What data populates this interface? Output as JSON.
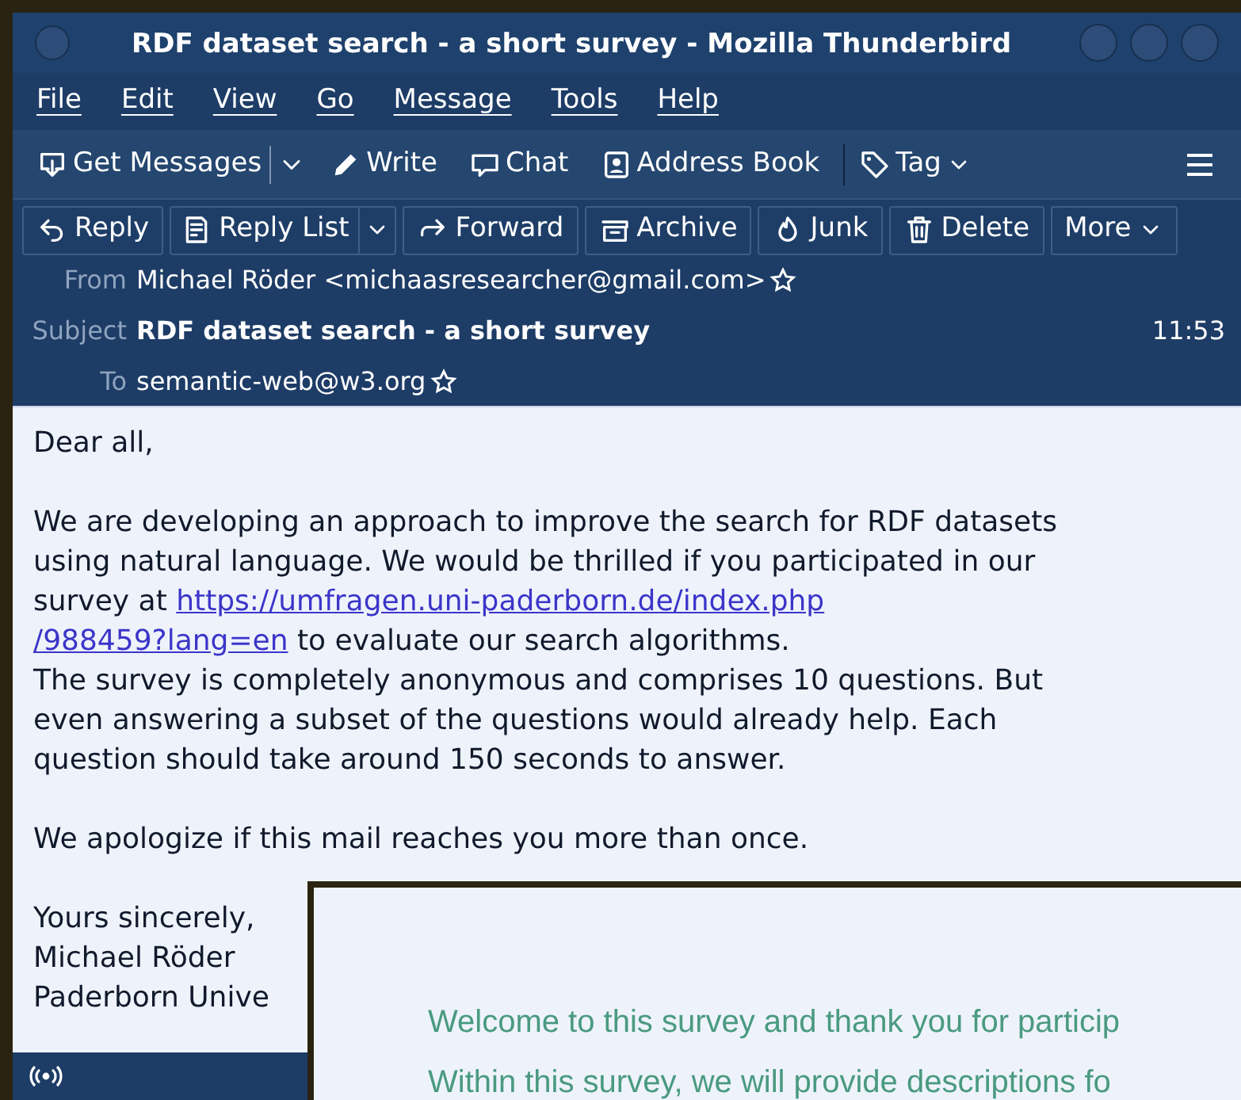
{
  "window": {
    "title": "RDF dataset search - a short survey - Mozilla Thunderbird"
  },
  "menu": [
    "File",
    "Edit",
    "View",
    "Go",
    "Message",
    "Tools",
    "Help"
  ],
  "toolbar": [
    {
      "kind": "get",
      "label": "Get Messages"
    },
    {
      "kind": "write",
      "label": "Write"
    },
    {
      "kind": "chat",
      "label": "Chat"
    },
    {
      "kind": "book",
      "label": "Address Book"
    },
    {
      "kind": "tag",
      "label": "Tag"
    }
  ],
  "actions": [
    {
      "kind": "reply",
      "label": "Reply"
    },
    {
      "kind": "replylist",
      "label": "Reply List"
    },
    {
      "kind": "forward",
      "label": "Forward"
    },
    {
      "kind": "archive",
      "label": "Archive"
    },
    {
      "kind": "junk",
      "label": "Junk"
    },
    {
      "kind": "delete",
      "label": "Delete"
    },
    {
      "kind": "more",
      "label": "More"
    }
  ],
  "header": {
    "from_label": "From",
    "from": "Michael Röder <michaasresearcher@gmail.com>",
    "subject_label": "Subject",
    "subject": "RDF dataset search - a short survey",
    "time": "11:53",
    "to_label": "To",
    "to": "semantic-web@w3.org"
  },
  "body": [
    [
      [
        {
          "kind": "text",
          "text": "Dear all,"
        }
      ]
    ],
    [
      [
        {
          "kind": "text",
          "text": "We are developing an approach to improve the search for RDF datasets"
        }
      ],
      [
        {
          "kind": "text",
          "text": "using natural language. We would be thrilled if you participated in our"
        }
      ],
      [
        {
          "kind": "text",
          "text": "survey at "
        },
        {
          "kind": "link",
          "text": "https://umfragen.uni-paderborn.de/index.php"
        }
      ],
      [
        {
          "kind": "link",
          "text": "/988459?lang=en"
        },
        {
          "kind": "text",
          "text": " to evaluate our search algorithms."
        }
      ],
      [
        {
          "kind": "text",
          "text": "The survey is completely anonymous and comprises 10 questions. But"
        }
      ],
      [
        {
          "kind": "text",
          "text": "even answering a subset of the questions would already help. Each"
        }
      ],
      [
        {
          "kind": "text",
          "text": "question should take around 150 seconds to answer."
        }
      ]
    ],
    [
      [
        {
          "kind": "text",
          "text": "We apologize if this mail reaches you more than once."
        }
      ]
    ],
    [
      [
        {
          "kind": "text",
          "text": "Yours sincerely,"
        }
      ],
      [
        {
          "kind": "text",
          "text": "Michael Röder"
        }
      ],
      [
        {
          "kind": "text",
          "text": "Paderborn Unive"
        }
      ]
    ]
  ],
  "survey_window": {
    "lines": [
      "Welcome to this survey and thank you for particip",
      "Within this survey, we will provide descriptions fo"
    ]
  }
}
